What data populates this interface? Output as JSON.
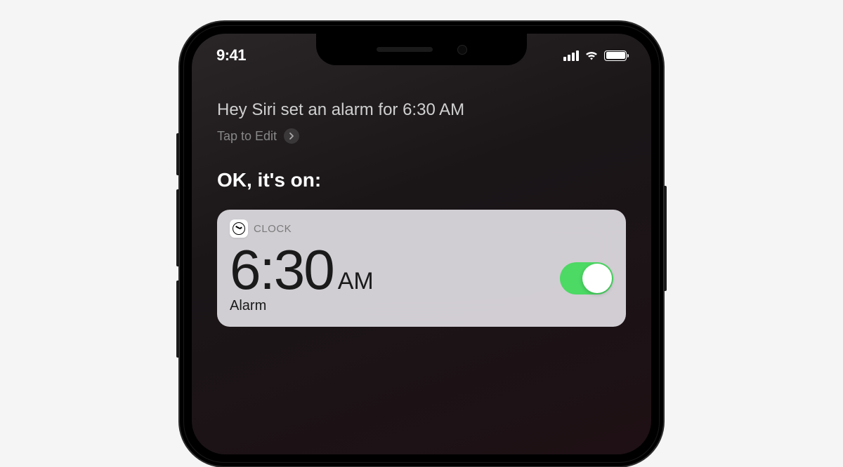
{
  "status": {
    "time": "9:41"
  },
  "siri": {
    "query": "Hey Siri set an alarm for 6:30 AM",
    "tap_to_edit": "Tap to Edit",
    "response": "OK, it's on:"
  },
  "card": {
    "app_name": "CLOCK",
    "alarm_time": "6:30",
    "alarm_ampm": "AM",
    "alarm_label": "Alarm",
    "toggle_on": true
  }
}
